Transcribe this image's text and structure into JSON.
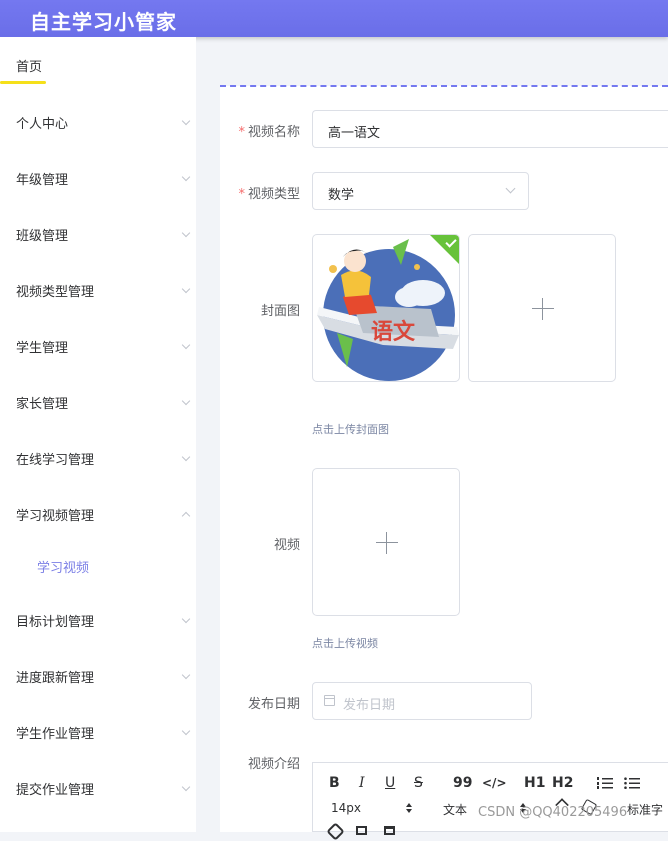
{
  "app": {
    "title": "自主学习小管家"
  },
  "sidebar": {
    "home": "首页",
    "items": [
      {
        "label": "个人中心"
      },
      {
        "label": "年级管理"
      },
      {
        "label": "班级管理"
      },
      {
        "label": "视频类型管理"
      },
      {
        "label": "学生管理"
      },
      {
        "label": "家长管理"
      },
      {
        "label": "在线学习管理"
      },
      {
        "label": "学习视频管理",
        "expanded": true
      },
      {
        "label": "目标计划管理"
      },
      {
        "label": "进度跟新管理"
      },
      {
        "label": "学生作业管理"
      },
      {
        "label": "提交作业管理"
      }
    ],
    "sub_item": "学习视频"
  },
  "form": {
    "video_name_label": "视频名称",
    "video_name_value": "高一语文",
    "video_type_label": "视频类型",
    "video_type_value": "数学",
    "cover_label": "封面图",
    "cover_hint": "点击上传封面图",
    "cover_image_text": "语文",
    "video_label": "视频",
    "video_hint": "点击上传视频",
    "date_label": "发布日期",
    "date_placeholder": "发布日期",
    "intro_label": "视频介绍"
  },
  "editor": {
    "bold": "B",
    "italic": "I",
    "underline": "U",
    "strike": "S",
    "quote": "99",
    "code": "</>",
    "h1": "H1",
    "h2": "H2",
    "font_size": "14px",
    "text_style": "文本",
    "font_family": "标准字"
  },
  "watermark": "CSDN @QQ402205496",
  "colors": {
    "header": "#7478f0",
    "accent": "#7b7fe6",
    "required": "#f56c6c",
    "success": "#67c23a"
  }
}
